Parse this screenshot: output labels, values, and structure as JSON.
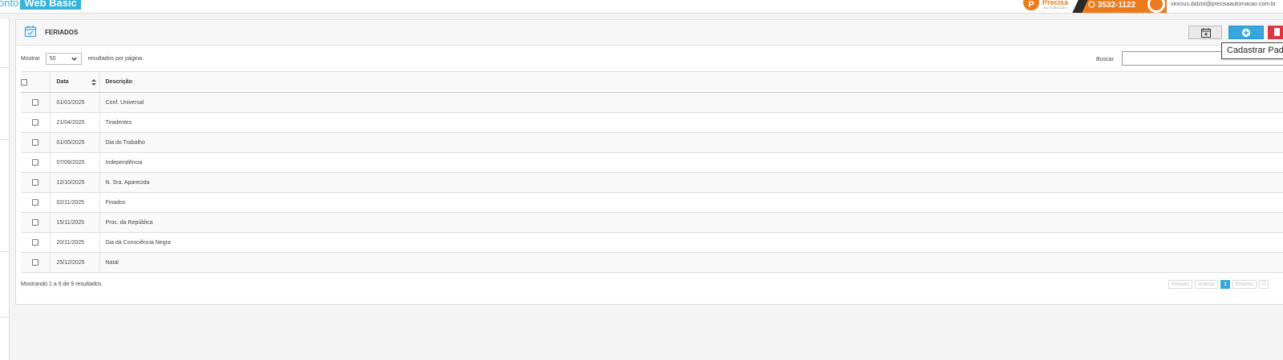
{
  "app": {
    "brand_prefix": "onto",
    "brand_highlight": "Web Basic",
    "banner": {
      "logo_letter": "P",
      "logo_name": "Precisa",
      "logo_sub": "AUTOMAÇÃO",
      "phone": "3532-1122"
    },
    "user_email": "vinicius.dalzot@precisaautomacao.com.br"
  },
  "panel": {
    "title": "FERIADOS",
    "tooltip": "Cadastrar Pad"
  },
  "controls": {
    "length_prefix": "Mostrar",
    "length_value": "50",
    "length_suffix": "resultados por página.",
    "search_label": "Buscar",
    "search_value": ""
  },
  "table": {
    "columns": [
      "Data",
      "Descrição"
    ],
    "rows": [
      {
        "date": "01/01/2025",
        "desc": "Conf. Universal"
      },
      {
        "date": "21/04/2025",
        "desc": "Tiradentes"
      },
      {
        "date": "01/05/2025",
        "desc": "Dia do Trabalho"
      },
      {
        "date": "07/09/2025",
        "desc": "Independência"
      },
      {
        "date": "12/10/2025",
        "desc": "N. Sra. Aparecida"
      },
      {
        "date": "02/11/2025",
        "desc": "Finados"
      },
      {
        "date": "15/11/2025",
        "desc": "Proc. da República"
      },
      {
        "date": "20/11/2025",
        "desc": "Dia da Consciência Negra"
      },
      {
        "date": "25/12/2025",
        "desc": "Natal"
      }
    ]
  },
  "footer": {
    "info": "Mostrando 1 a 9 de 9 resultados.",
    "pager": {
      "first": "Primeiro",
      "prev": "Anterior",
      "current": "1",
      "next": "Próximo",
      "last": "Ú"
    }
  },
  "colors": {
    "accent": "#35a7dd",
    "danger": "#e0353f",
    "banner_orange": "#ec7b1d"
  }
}
